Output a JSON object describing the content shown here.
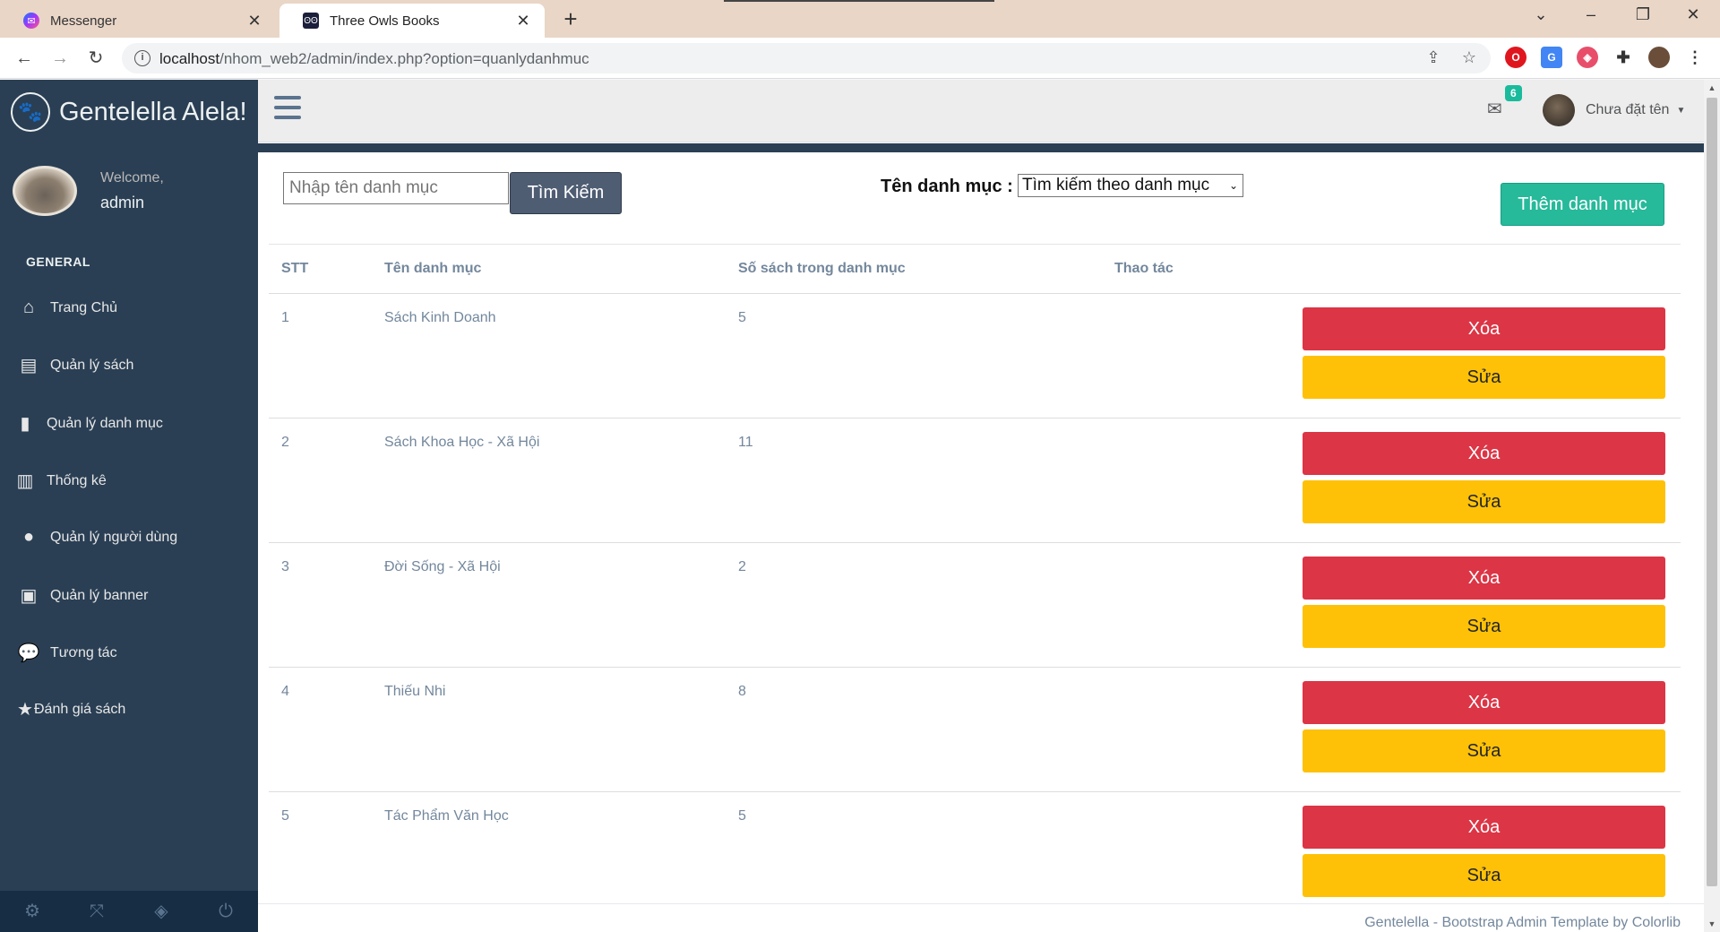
{
  "browser": {
    "tabs": [
      {
        "title": "Messenger",
        "favicon": "messenger-icon",
        "active": false
      },
      {
        "title": "Three Owls Books",
        "favicon": "owl-icon",
        "active": true
      }
    ],
    "new_tab": "+",
    "url_host": "localhost",
    "url_path": "/nhom_web2/admin/index.php?option=quanlydanhmuc"
  },
  "sidebar": {
    "brand": "Gentelella Alela!",
    "welcome": "Welcome,",
    "username": "admin",
    "section": "GENERAL",
    "items": [
      {
        "label": "Trang Chủ",
        "icon": "home-icon"
      },
      {
        "label": "Quản lý sách",
        "icon": "book-icon"
      },
      {
        "label": "Quản lý danh mục",
        "icon": "bookmark-icon"
      },
      {
        "label": "Thống kê",
        "icon": "bar-chart-icon"
      },
      {
        "label": "Quản lý người dùng",
        "icon": "user-icon"
      },
      {
        "label": "Quản lý banner",
        "icon": "image-icon"
      },
      {
        "label": "Tương tác",
        "icon": "comments-icon"
      },
      {
        "label": "Đánh giá sách",
        "icon": "star-icon"
      }
    ]
  },
  "topnav": {
    "mail_count": "6",
    "user_name": "Chưa đặt tên"
  },
  "toolbar": {
    "search_placeholder": "Nhập tên danh mục",
    "search_button": "Tìm Kiếm",
    "filter_label": "Tên danh mục :",
    "filter_selected": "Tìm kiếm theo danh mục",
    "add_button": "Thêm danh mục"
  },
  "table": {
    "headers": [
      "STT",
      "Tên danh mục",
      "Số sách trong danh mục",
      "Thao tác"
    ],
    "rows": [
      {
        "stt": "1",
        "name": "Sách Kinh Doanh",
        "count": "5",
        "delete": "Xóa",
        "edit": "Sửa"
      },
      {
        "stt": "2",
        "name": "Sách Khoa Học - Xã Hội",
        "count": "11",
        "delete": "Xóa",
        "edit": "Sửa"
      },
      {
        "stt": "3",
        "name": "Đời Sống - Xã Hội",
        "count": "2",
        "delete": "Xóa",
        "edit": "Sửa"
      },
      {
        "stt": "4",
        "name": "Thiếu Nhi",
        "count": "8",
        "delete": "Xóa",
        "edit": "Sửa"
      },
      {
        "stt": "5",
        "name": "Tác Phẩm Văn Học",
        "count": "5",
        "delete": "Xóa",
        "edit": "Sửa"
      }
    ]
  },
  "footer": {
    "text": "Gentelella - Bootstrap Admin Template by Colorlib"
  },
  "colors": {
    "sidebar": "#2A3F54",
    "accent": "#26B99A",
    "danger": "#DC3545",
    "warning": "#FFC107"
  }
}
